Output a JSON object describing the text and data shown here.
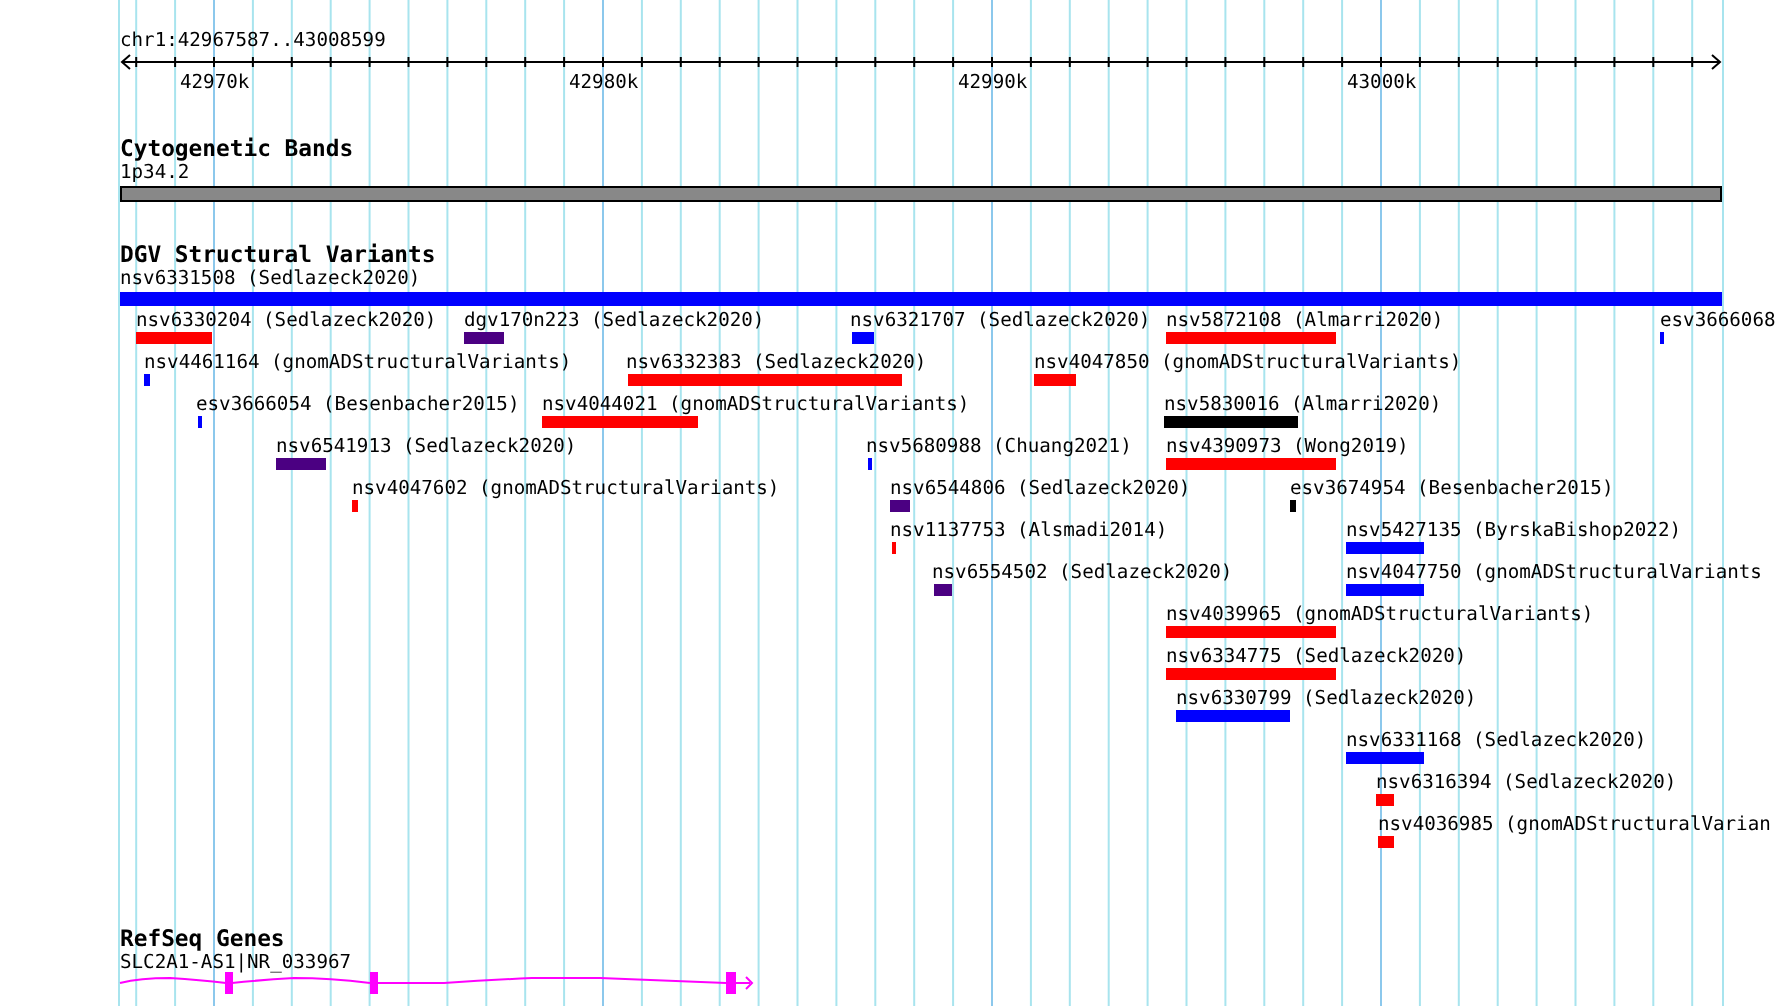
{
  "location": "chr1:42967587..43008599",
  "ruler": {
    "ticks": [
      "42970k",
      "42980k",
      "42990k",
      "43000k"
    ]
  },
  "tracks": [
    {
      "kind": "bands",
      "title": "Cytogenetic Bands",
      "band_label": "1p34.2"
    },
    {
      "kind": "variants",
      "title": "DGV Structural Variants",
      "features": [
        {
          "label": "nsv6331508 (Sedlazeck2020)",
          "color": "#0000ff"
        },
        {
          "label": "nsv6330204 (Sedlazeck2020)",
          "color": "#ff0000"
        },
        {
          "label": "dgv170n223 (Sedlazeck2020)",
          "color": "#4b0082"
        },
        {
          "label": "nsv6321707 (Sedlazeck2020)",
          "color": "#0000ff"
        },
        {
          "label": "nsv5872108 (Almarri2020)",
          "color": "#ff0000"
        },
        {
          "label": "esv3666068",
          "color": "#0000ff"
        },
        {
          "label": "nsv4461164 (gnomADStructuralVariants)",
          "color": "#0000ff"
        },
        {
          "label": "nsv6332383 (Sedlazeck2020)",
          "color": "#ff0000"
        },
        {
          "label": "nsv4047850 (gnomADStructuralVariants)",
          "color": "#ff0000"
        },
        {
          "label": "esv3666054 (Besenbacher2015)",
          "color": "#0000ff"
        },
        {
          "label": "nsv4044021 (gnomADStructuralVariants)",
          "color": "#ff0000"
        },
        {
          "label": "nsv5830016 (Almarri2020)",
          "color": "#000000"
        },
        {
          "label": "nsv6541913 (Sedlazeck2020)",
          "color": "#4b0082"
        },
        {
          "label": "nsv5680988 (Chuang2021)",
          "color": "#0000ff"
        },
        {
          "label": "nsv4390973 (Wong2019)",
          "color": "#ff0000"
        },
        {
          "label": "nsv4047602 (gnomADStructuralVariants)",
          "color": "#ff0000"
        },
        {
          "label": "nsv6544806 (Sedlazeck2020)",
          "color": "#4b0082"
        },
        {
          "label": "esv3674954 (Besenbacher2015)",
          "color": "#000000"
        },
        {
          "label": "nsv1137753 (Alsmadi2014)",
          "color": "#ff0000"
        },
        {
          "label": "nsv5427135 (ByrskaBishop2022)",
          "color": "#0000ff"
        },
        {
          "label": "nsv6554502 (Sedlazeck2020)",
          "color": "#4b0082"
        },
        {
          "label": "nsv4047750 (gnomADStructuralVariants",
          "color": "#0000ff"
        },
        {
          "label": "nsv4039965 (gnomADStructuralVariants)",
          "color": "#ff0000"
        },
        {
          "label": "nsv6334775 (Sedlazeck2020)",
          "color": "#ff0000"
        },
        {
          "label": "nsv6330799 (Sedlazeck2020)",
          "color": "#0000ff"
        },
        {
          "label": "nsv6331168 (Sedlazeck2020)",
          "color": "#0000ff"
        },
        {
          "label": "nsv6316394 (Sedlazeck2020)",
          "color": "#ff0000"
        },
        {
          "label": "nsv4036985 (gnomADStructuralVarian",
          "color": "#ff0000"
        }
      ]
    },
    {
      "kind": "genes",
      "title": "RefSeq Genes",
      "genes": [
        {
          "label": "SLC2A1-AS1|NR_033967"
        }
      ]
    }
  ]
}
